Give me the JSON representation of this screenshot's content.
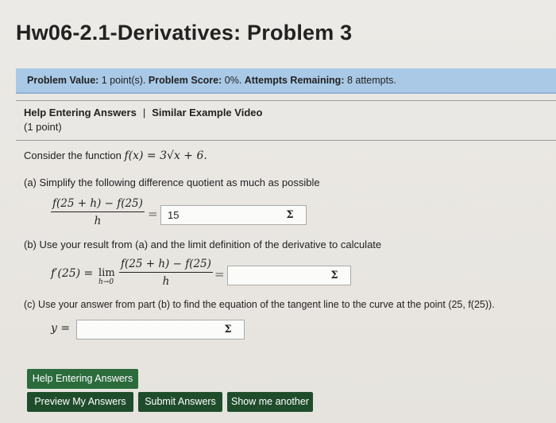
{
  "title": "Hw06-2.1-Derivatives: Problem 3",
  "info": {
    "value_label": "Problem Value:",
    "value": "1 point(s).",
    "score_label": "Problem Score:",
    "score": "0%.",
    "attempts_label": "Attempts Remaining:",
    "attempts": "8 attempts."
  },
  "links": {
    "help": "Help Entering Answers",
    "separator": "|",
    "video": "Similar Example Video"
  },
  "points": "(1 point)",
  "intro": {
    "text": "Consider the function",
    "formula": "f(x) = 3√x + 6."
  },
  "part_a": {
    "text": "(a)  Simplify the following difference quotient as much as possible",
    "numerator": "f(25 + h) − f(25)",
    "denominator": "h",
    "equals": "=",
    "answer": "15",
    "sigma": "Σ"
  },
  "part_b": {
    "text": "(b)  Use your result from (a) and the limit definition of the derivative to calculate",
    "lhs": "f′(25) =",
    "lim": "lim",
    "lim_sub": "h→0",
    "numerator": "f(25 + h) − f(25)",
    "denominator": "h",
    "equals": "=",
    "answer": "",
    "sigma": "Σ"
  },
  "part_c": {
    "text": "(c)  Use your answer from part (b) to find the equation of the tangent line to the curve at the point (25, f(25)).",
    "lhs": "y =",
    "answer": "",
    "sigma": "Σ"
  },
  "buttons": {
    "help": "Help Entering Answers",
    "preview": "Preview My Answers",
    "submit": "Submit Answers",
    "another": "Show me another"
  }
}
